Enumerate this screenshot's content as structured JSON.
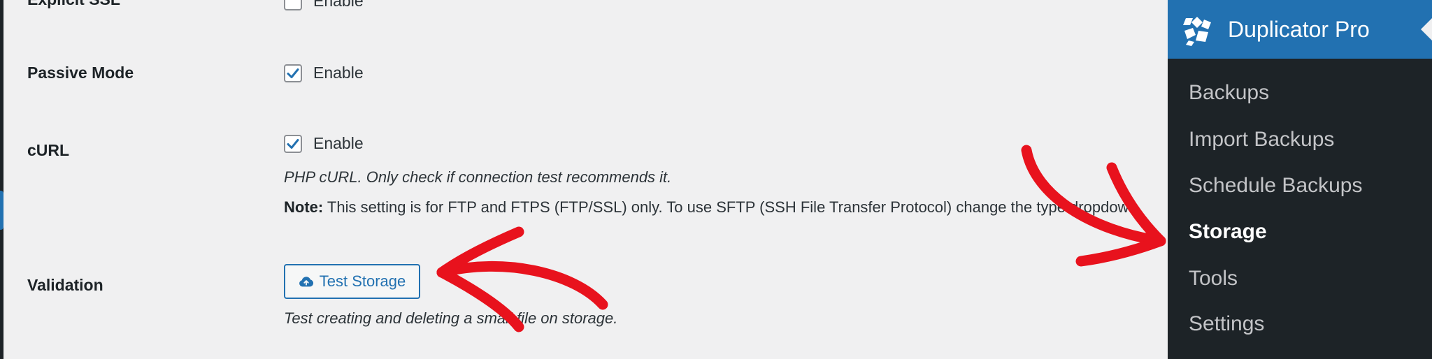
{
  "rows": {
    "explicit_ssl": {
      "label": "Explicit SSL",
      "check_label": "Enable",
      "checked": false
    },
    "passive_mode": {
      "label": "Passive Mode",
      "check_label": "Enable",
      "checked": true
    },
    "curl": {
      "label": "cURL",
      "check_label": "Enable",
      "checked": true,
      "description": "PHP cURL. Only check if connection test recommends it.",
      "note_label": "Note:",
      "note_text": " This setting is for FTP and FTPS (FTP/SSL) only. To use SFTP (SSH File Transfer Protocol) change the type dropdown"
    },
    "validation": {
      "label": "Validation",
      "button_label": "Test Storage",
      "description": "Test creating and deleting a small file on storage."
    }
  },
  "sidebar": {
    "title": "Duplicator Pro",
    "items": [
      {
        "label": "Backups",
        "active": false
      },
      {
        "label": "Import Backups",
        "active": false
      },
      {
        "label": "Schedule Backups",
        "active": false
      },
      {
        "label": "Storage",
        "active": true
      },
      {
        "label": "Tools",
        "active": false
      },
      {
        "label": "Settings",
        "active": false
      }
    ]
  },
  "icons": {
    "check": "checkmark-icon",
    "button": "cloud-upload-icon",
    "logo": "duplicator-logo-icon"
  },
  "colors": {
    "accent": "#2271b1",
    "sidebar_bg": "#1d2327",
    "annotation": "#e8121d"
  }
}
